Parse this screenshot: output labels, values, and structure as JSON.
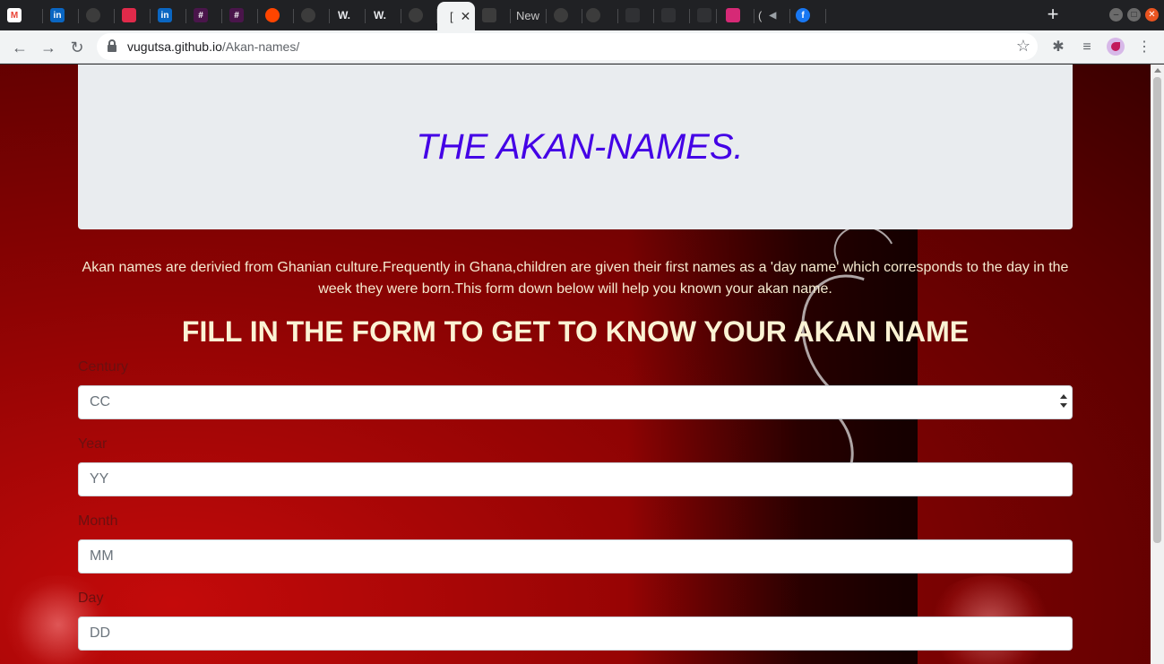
{
  "browser": {
    "tabs": [
      {
        "icon": "gmail-icon",
        "title": "",
        "color": "#ea4335",
        "glyph": "M"
      },
      {
        "icon": "linkedin-icon",
        "title": "",
        "color": "#0a66c2",
        "glyph": "in"
      },
      {
        "icon": "upwork-icon",
        "title": "",
        "color": "#3c3c3c",
        "glyph": ""
      },
      {
        "icon": "app-icon",
        "title": "",
        "color": "#e02a4a",
        "glyph": ""
      },
      {
        "icon": "linkedin-icon",
        "title": "",
        "color": "#0a66c2",
        "glyph": "in"
      },
      {
        "icon": "slack-icon",
        "title": "",
        "color": "#4a154b",
        "glyph": "#"
      },
      {
        "icon": "slack-icon",
        "title": "",
        "color": "#4a154b",
        "glyph": "#"
      },
      {
        "icon": "reddit-icon",
        "title": "",
        "color": "#ff4500",
        "glyph": ""
      },
      {
        "icon": "upwork-icon",
        "title": "",
        "color": "#3c3c3c",
        "glyph": ""
      },
      {
        "icon": "wikipedia-icon",
        "title": "",
        "color": "#202124",
        "glyph": "W."
      },
      {
        "icon": "wikipedia-icon",
        "title": "",
        "color": "#202124",
        "glyph": "W."
      },
      {
        "icon": "github-icon",
        "title": "",
        "color": "#3c3c3c",
        "glyph": ""
      },
      {
        "icon": "page-icon",
        "title": "[",
        "color": "#f1f3f4",
        "glyph": "",
        "active": true
      },
      {
        "icon": "page-icon",
        "title": "",
        "color": "#3c3c3c",
        "glyph": ""
      },
      {
        "icon": "new-tab-icon",
        "title": "New",
        "color": "#3c3c3c",
        "glyph": ""
      },
      {
        "icon": "upwork-icon",
        "title": "",
        "color": "#3c3c3c",
        "glyph": ""
      },
      {
        "icon": "github-icon",
        "title": "",
        "color": "#3c3c3c",
        "glyph": ""
      },
      {
        "icon": "instagram-icon",
        "title": "",
        "color": "#d62976",
        "glyph": ""
      },
      {
        "icon": "audio-icon",
        "title": "(",
        "color": "#3c3c3c",
        "glyph": ""
      },
      {
        "icon": "facebook-icon",
        "title": "",
        "color": "#1877f2",
        "glyph": "f"
      }
    ],
    "url_host": "vugutsa.github.io",
    "url_path": "/Akan-names/"
  },
  "page": {
    "heading": "THE AKAN-NAMES.",
    "intro": "Akan names are derivied from Ghanian culture.Frequently in Ghana,children are given their first names as a 'day name' which corresponds to the day in the week they were born.This form down below will help you known your akan name.",
    "form_title": "FILL IN THE FORM TO GET TO KNOW YOUR AKAN NAME",
    "fields": [
      {
        "label": "Century",
        "placeholder": "CC"
      },
      {
        "label": "Year",
        "placeholder": "YY"
      },
      {
        "label": "Month",
        "placeholder": "MM"
      },
      {
        "label": "Day",
        "placeholder": "DD"
      }
    ]
  },
  "colors": {
    "heading": "#4400e6",
    "background": "#8e0303",
    "jumbotron": "#e9ecef"
  }
}
